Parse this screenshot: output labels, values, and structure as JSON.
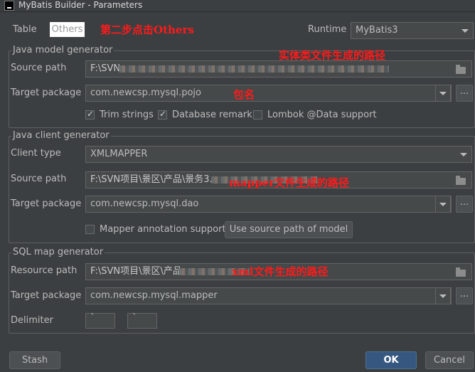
{
  "window": {
    "title": "MyBatis Builder - Parameters"
  },
  "tabs": [
    {
      "label": "Table"
    },
    {
      "label": "Others"
    }
  ],
  "annotations": {
    "click_others": "第二步点击Others",
    "entity_path": "实体类文件生成的路径",
    "package_name": "包名",
    "mapper_path": "mapper文件生成的路径",
    "xml_path": "xml文件生成的路径"
  },
  "runtime": {
    "label": "Runtime",
    "value": "MyBatis3"
  },
  "java_model": {
    "title": "Java model generator",
    "source_path_label": "Source path",
    "source_path_value": "F:\\SVN",
    "target_package_label": "Target package",
    "target_package_value": "com.newcsp.mysql.pojo",
    "trim_strings": "Trim strings",
    "database_remark": "Database remark",
    "lombok": "Lombok @Data support"
  },
  "java_client": {
    "title": "Java client generator",
    "client_type_label": "Client type",
    "client_type_value": "XMLMAPPER",
    "source_path_label": "Source path",
    "source_path_value": "F:\\SVN项目\\景区\\产品\\景务3.",
    "target_package_label": "Target package",
    "target_package_value": "com.newcsp.mysql.dao",
    "mapper_annotation": "Mapper annotation support",
    "use_source_path": "Use source path of model"
  },
  "sql_map": {
    "title": "SQL map generator",
    "resource_path_label": "Resource path",
    "resource_path_value": "F:\\SVN项目\\景区\\产品",
    "target_package_label": "Target package",
    "target_package_value": "com.newcsp.mysql.mapper",
    "delimiter_label": "Delimiter",
    "delimiter_open": "`",
    "delimiter_close": "`"
  },
  "footer": {
    "stash": "Stash",
    "ok": "OK",
    "cancel": "Cancel"
  },
  "ellipsis": "..."
}
